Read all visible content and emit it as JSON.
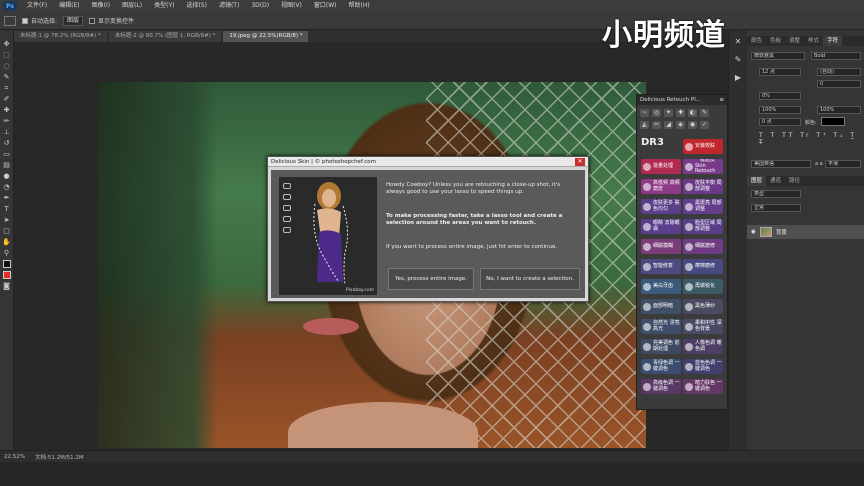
{
  "menubar": {
    "logo": "Ps",
    "items": [
      "文件(F)",
      "编辑(E)",
      "图像(I)",
      "图层(L)",
      "类型(Y)",
      "选择(S)",
      "滤镜(T)",
      "3D(D)",
      "视图(V)",
      "窗口(W)",
      "帮助(H)"
    ]
  },
  "options": {
    "auto_select": "自动选择:",
    "auto_select_target": "图层",
    "show_transform": "显示变换控件"
  },
  "tabs": [
    "未标题-1 @ 78.2% (RGB/8#) *",
    "未标题-2 @ 80.7% (图层 1, RGB/8#) *",
    "19.jpeg @ 22.5%(RGB/8) *"
  ],
  "watermark": "小明频道",
  "dialog": {
    "title": "Delicious Skin | © photoshopchef.com",
    "thumb_credit": "Pixabay.com",
    "intro": "Howdy Cowboy? Unless you are retouching a close-up shot, it's always good to use your lasso to speed things up.",
    "instruction": "To make processing faster, take a lasso tool and create a selection around the areas you want to retouch.",
    "entire_hint": "If you want to process entire image, just hit enter to continue.",
    "btn_process": "Yes, process entire image.",
    "btn_selection": "No, I want to create a selection."
  },
  "plugin": {
    "title": "Delicious Retouch Pl...",
    "logo": "DR3",
    "top_icons": [
      "~",
      "◎",
      "✦",
      "✚",
      "◐",
      "✎",
      "◭",
      "✂",
      "◢",
      "◈",
      "◉",
      "✓"
    ],
    "buttons": [
      {
        "label": "安装校肤",
        "color": "#c0272d"
      },
      {
        "label": "批量处理",
        "color": "#b12a4f"
      },
      {
        "label": "一键磨皮 Skin Retouch",
        "color": "#7a3a8a"
      },
      {
        "label": "高低频 高频磨皮",
        "color": "#8d3a86"
      },
      {
        "label": "皮肤平衡 局部调整",
        "color": "#6a3a88"
      },
      {
        "label": "皮肤更多 肤色均匀",
        "color": "#5a3f8a"
      },
      {
        "label": "黑斑亮 局部调整",
        "color": "#643d8c"
      },
      {
        "label": "眼睛 去除眼袋",
        "color": "#5b3f8d"
      },
      {
        "label": "脸型区域 局部调整",
        "color": "#573e86"
      },
      {
        "label": "细腻模糊",
        "color": "#7a3d7a"
      },
      {
        "label": "细腻磨修",
        "color": "#6f3b82"
      },
      {
        "label": "智能修复",
        "color": "#4d4a82"
      },
      {
        "label": "摩擦磨修",
        "color": "#474a80"
      },
      {
        "label": "美白牙齿",
        "color": "#3a5a7a"
      },
      {
        "label": "再做锐化",
        "color": "#3a5a66"
      },
      {
        "label": "面部明暗",
        "color": "#3f4f66"
      },
      {
        "label": "黑色薄纱",
        "color": "#4a4a60"
      },
      {
        "label": "自然光 漂亮高光",
        "color": "#3e4e6a"
      },
      {
        "label": "柔和中性 深色背景",
        "color": "#4a4a66"
      },
      {
        "label": "完美调色 前期处理",
        "color": "#3e4a62"
      },
      {
        "label": "人像色调 暖色调",
        "color": "#4c3e66"
      },
      {
        "label": "青绿色调 一键调色",
        "color": "#3a4c70"
      },
      {
        "label": "蓝色色调 一键调色",
        "color": "#413f6c"
      },
      {
        "label": "高级色调 一键调色",
        "color": "#5a3866"
      },
      {
        "label": "暗力肤色 一键调色",
        "color": "#643664"
      }
    ]
  },
  "right_panel": {
    "tabs_top": [
      "颜色",
      "色板",
      "调整",
      "样式",
      "字符"
    ],
    "font_name": "微软雅黑",
    "font_style": "Bold",
    "font_size": "12 点",
    "leading": "(自动)",
    "tracking": "0",
    "kerning": "0%",
    "scale_v": "100%",
    "scale_h": "100%",
    "baseline": "0 点",
    "color_label": "颜色:",
    "lang": "美国英语",
    "aa": "平滑",
    "aa_prefix": "a a",
    "layer_tabs": [
      "图层",
      "通道",
      "路径"
    ],
    "layer_kind": "类型",
    "layer_mode": "正常",
    "layer_name": "背景"
  },
  "status": {
    "zoom": "22.52%",
    "doc": "文档:51.2M/51.2M"
  }
}
